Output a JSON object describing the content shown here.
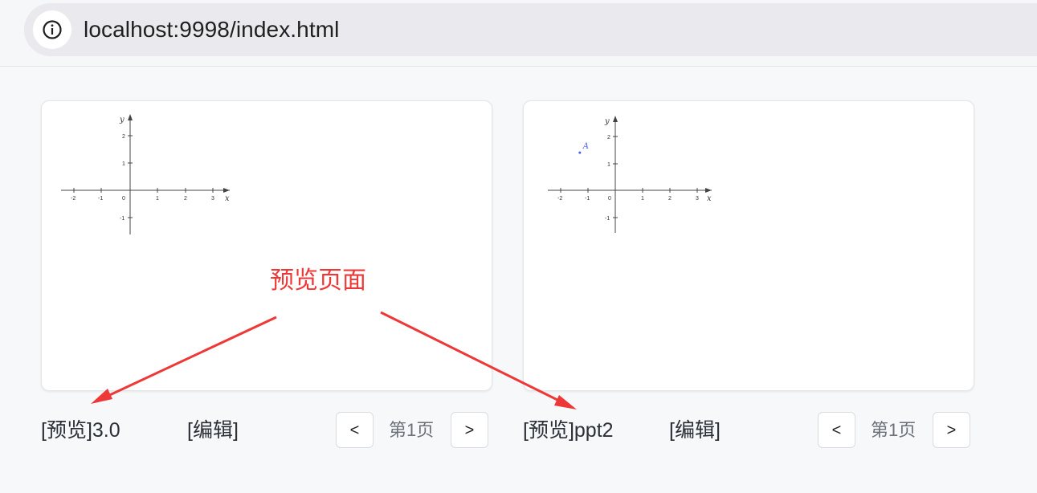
{
  "browser": {
    "url": "localhost:9998/index.html",
    "info_icon": "info-circle-icon"
  },
  "graph_axes": {
    "x_axis_label": "x",
    "y_axis_label": "y",
    "x_ticks": [
      "-2",
      "-1",
      "0",
      "1",
      "2",
      "3"
    ],
    "y_ticks": [
      "2",
      "1",
      "-1"
    ]
  },
  "cards": [
    {
      "title": "[预览]3.0",
      "edit_label": "[编辑]",
      "prev_label": "<",
      "next_label": ">",
      "page_label": "第1页",
      "point": null
    },
    {
      "title": "[预览]ppt2",
      "edit_label": "[编辑]",
      "prev_label": "<",
      "next_label": ">",
      "page_label": "第1页",
      "point": {
        "label": "A",
        "x": -1.3,
        "y": 1.4,
        "color": "#4a5cf0"
      }
    }
  ],
  "annotation": {
    "text": "预览页面",
    "color": "#ee3838"
  }
}
